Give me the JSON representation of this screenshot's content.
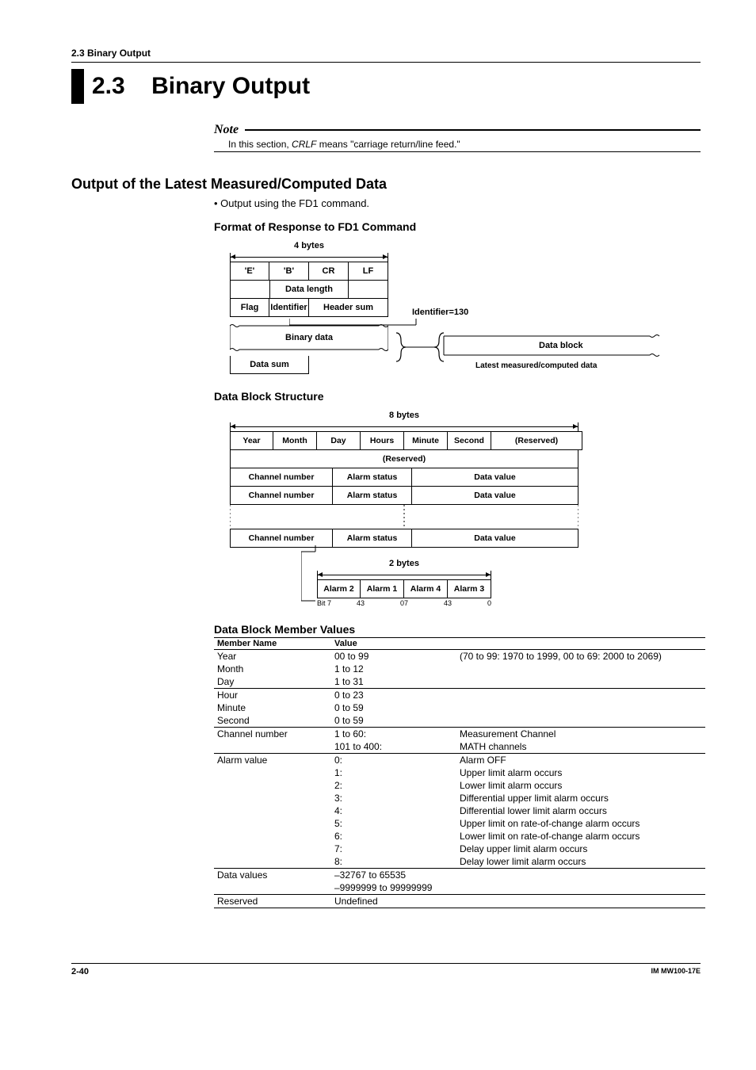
{
  "running_head": "2.3  Binary Output",
  "section_number": "2.3",
  "section_title": "Binary Output",
  "note": {
    "label": "Note",
    "text_prefix": "In this section, ",
    "text_em": "CRLF",
    "text_suffix": " means \"carriage return/line feed.\""
  },
  "h2": "Output of the Latest Measured/Computed Data",
  "bullet": "Output using the FD1 command.",
  "subhead1": "Format of Response to FD1 Command",
  "diag1": {
    "dim_label": "4 bytes",
    "row1": [
      "'E'",
      "'B'",
      "CR",
      "LF"
    ],
    "row2": "Data length",
    "row3": [
      "Flag",
      "Identifier",
      "Header sum"
    ],
    "row4": "Binary data",
    "row5": "Data sum",
    "id_label": "Identifier=130",
    "db_label": "Data block",
    "latest_label": "Latest measured/computed data"
  },
  "subhead2": "Data Block Structure",
  "diag2": {
    "dim_label": "8 bytes",
    "row1": [
      "Year",
      "Month",
      "Day",
      "Hours",
      "Minute",
      "Second",
      "(Reserved)"
    ],
    "reserved": "(Reserved)",
    "ch_label": "Channel number",
    "as_label": "Alarm status",
    "dv_label": "Data value",
    "dim2_label": "2 bytes",
    "alarms": [
      "Alarm 2",
      "Alarm 1",
      "Alarm 4",
      "Alarm 3"
    ],
    "bits": [
      "Bit 7",
      "4",
      "3",
      "0",
      "7",
      "4",
      "3",
      "0"
    ]
  },
  "subhead3": "Data Block Member Values",
  "table": {
    "head": [
      "Member Name",
      "Value"
    ],
    "rows": [
      {
        "sep": true,
        "name": "Year",
        "val": "00 to 99",
        "desc": "(70 to 99: 1970 to 1999, 00 to 69: 2000 to 2069)"
      },
      {
        "sep": false,
        "name": "Month",
        "val": "1 to 12",
        "desc": ""
      },
      {
        "sep": false,
        "name": "Day",
        "val": "1 to 31",
        "desc": ""
      },
      {
        "sep": true,
        "name": "Hour",
        "val": "0 to 23",
        "desc": ""
      },
      {
        "sep": false,
        "name": "Minute",
        "val": "0 to 59",
        "desc": ""
      },
      {
        "sep": false,
        "name": "Second",
        "val": "0 to 59",
        "desc": ""
      },
      {
        "sep": true,
        "name": "Channel number",
        "val": "1 to 60:",
        "desc": "Measurement Channel"
      },
      {
        "sep": false,
        "name": "",
        "val": "101 to 400:",
        "desc": "MATH channels"
      },
      {
        "sep": true,
        "name": "Alarm value",
        "val": "0:",
        "desc": "Alarm OFF"
      },
      {
        "sep": false,
        "name": "",
        "val": "1:",
        "desc": "Upper limit alarm occurs"
      },
      {
        "sep": false,
        "name": "",
        "val": "2:",
        "desc": "Lower limit alarm occurs"
      },
      {
        "sep": false,
        "name": "",
        "val": "3:",
        "desc": "Differential upper limit alarm occurs"
      },
      {
        "sep": false,
        "name": "",
        "val": "4:",
        "desc": "Differential lower limit alarm occurs"
      },
      {
        "sep": false,
        "name": "",
        "val": "5:",
        "desc": "Upper limit on rate-of-change alarm occurs"
      },
      {
        "sep": false,
        "name": "",
        "val": "6:",
        "desc": "Lower limit on rate-of-change alarm occurs"
      },
      {
        "sep": false,
        "name": "",
        "val": "7:",
        "desc": "Delay upper limit alarm occurs"
      },
      {
        "sep": false,
        "name": "",
        "val": "8:",
        "desc": "Delay lower limit alarm occurs"
      },
      {
        "sep": true,
        "name": "Data values",
        "val": "–32767 to 65535",
        "desc": ""
      },
      {
        "sep": false,
        "name": "",
        "val": "–9999999 to 99999999",
        "desc": ""
      },
      {
        "sep": true,
        "name": "Reserved",
        "val": "Undefined",
        "desc": ""
      }
    ]
  },
  "footer": {
    "left": "2-40",
    "right": "IM MW100-17E"
  }
}
